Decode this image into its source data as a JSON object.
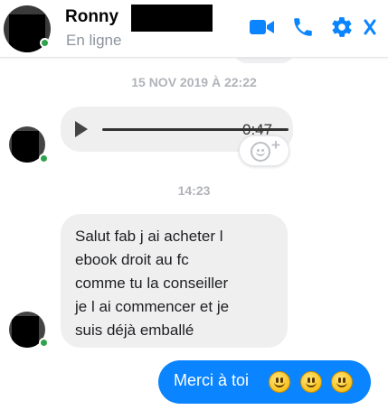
{
  "header": {
    "contact_name": "Ronny",
    "status": "En ligne",
    "icons": [
      "video-call-icon",
      "phone-icon",
      "gear-icon",
      "close-icon"
    ],
    "accent_color": "#0a84ff"
  },
  "thread": {
    "timestamp_1": "15 NOV 2019 À 22:22",
    "audio_message": {
      "duration": "0:47"
    },
    "timestamp_2": "14:23",
    "received_message": "Salut fab j ai acheter l\nebook  droit au fc\ncomme tu la conseiller\nje l ai commencer et je\nsuis déjà emballé",
    "sent_message": "Merci à toi",
    "sent_emojis": [
      "smiley-emoji",
      "smiley-emoji",
      "smiley-emoji"
    ]
  },
  "colors": {
    "received_bubble": "#f0eff0",
    "sent_bubble": "#0a84ff",
    "online": "#31a24c",
    "timestamp": "#b0b3b8"
  }
}
